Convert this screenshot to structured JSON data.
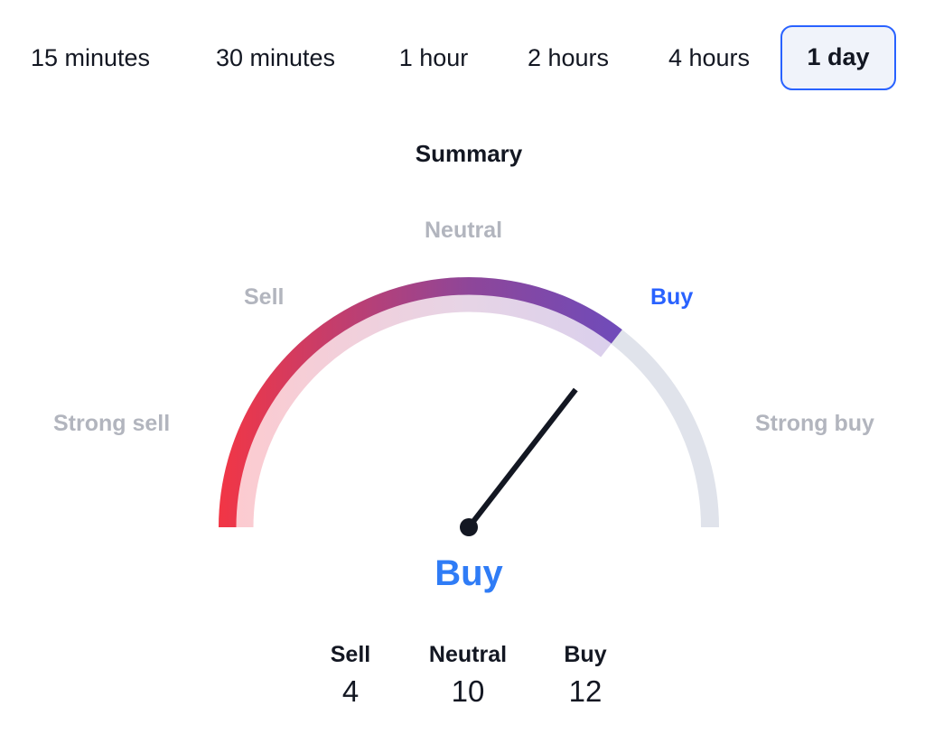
{
  "tabs": [
    {
      "label": "15 minutes",
      "active": false
    },
    {
      "label": "30 minutes",
      "active": false
    },
    {
      "label": "1 hour",
      "active": false
    },
    {
      "label": "2 hours",
      "active": false
    },
    {
      "label": "4 hours",
      "active": false
    },
    {
      "label": "1 day",
      "active": true
    }
  ],
  "summary": {
    "title": "Summary",
    "verdict": "Buy",
    "gauge_labels": {
      "strong_sell": "Strong sell",
      "sell": "Sell",
      "neutral": "Neutral",
      "buy": "Buy",
      "strong_buy": "Strong buy"
    },
    "active_label": "buy",
    "needle_value_approx": 0.71,
    "counts": [
      {
        "label": "Sell",
        "value": "4"
      },
      {
        "label": "Neutral",
        "value": "10"
      },
      {
        "label": "Buy",
        "value": "12"
      }
    ]
  },
  "colors": {
    "accent": "#2962ff",
    "verdict_buy": "#2f7cf6",
    "gauge_start": "#f23645",
    "gauge_mid": "#a0448c",
    "gauge_end": "#6a4cbf",
    "gauge_track": "#e0e3eb",
    "needle": "#131722",
    "inactive_label": "#b2b5be"
  }
}
